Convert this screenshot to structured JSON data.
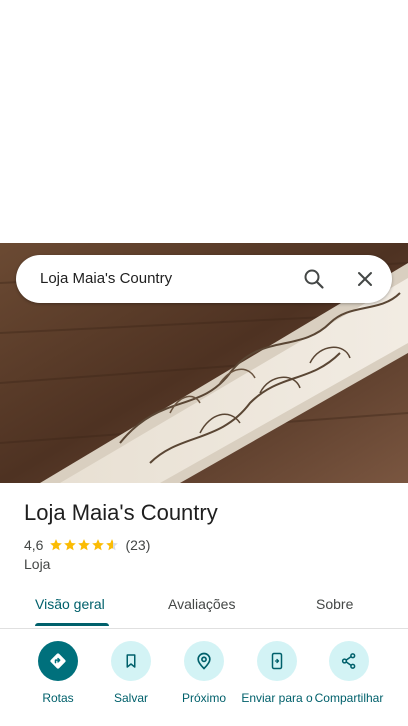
{
  "search": {
    "query": "Loja Maia's Country"
  },
  "place": {
    "title": "Loja Maia's Country",
    "rating": "4,6",
    "stars": 4.6,
    "review_count": "(23)",
    "category": "Loja"
  },
  "tabs": [
    {
      "label": "Visão geral"
    },
    {
      "label": "Avaliações"
    },
    {
      "label": "Sobre"
    }
  ],
  "actions": [
    {
      "label": "Rotas",
      "icon": "directions-icon"
    },
    {
      "label": "Salvar",
      "icon": "bookmark-icon"
    },
    {
      "label": "Próximo",
      "icon": "nearby-icon"
    },
    {
      "label": "Enviar para o",
      "icon": "send-to-phone-icon"
    },
    {
      "label": "Compartilhar",
      "icon": "share-icon"
    }
  ],
  "colors": {
    "accent": "#00606b",
    "star": "#fbbc04",
    "chip": "#d3f3f5"
  }
}
